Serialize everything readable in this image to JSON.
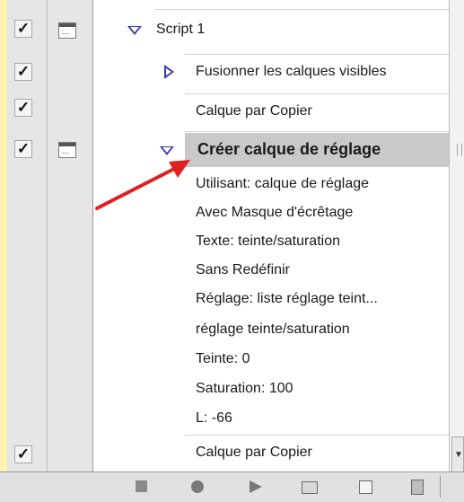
{
  "actions": {
    "script": {
      "label": "Script 1"
    },
    "items": [
      {
        "label": "Fusionner les calques visibles"
      },
      {
        "label": "Calque par Copier"
      },
      {
        "label": "Créer calque de réglage"
      },
      {
        "label": "Calque par Copier"
      }
    ],
    "details": [
      "Utilisant: calque de réglage",
      "Avec Masque d'écrêtage",
      "Texte: teinte/saturation",
      "Sans Redéfinir",
      "Réglage: liste réglage teint...",
      "réglage teinte/saturation",
      "Teinte: 0",
      "Saturation: 100",
      "L: -66"
    ],
    "check_glyph": "✓",
    "dialog_glyph": "..."
  },
  "icons": [
    "checkmark-icon",
    "dialog-toggle-icon",
    "expand-triangle-icon",
    "collapse-triangle-icon",
    "stop-icon",
    "record-icon",
    "play-icon",
    "new-set-icon",
    "new-action-icon",
    "trash-icon",
    "red-arrow-annotation"
  ],
  "colors": {
    "selected_row": "#c9c9c9",
    "triangle": "#3a3aa8",
    "arrow": "#e02020"
  }
}
